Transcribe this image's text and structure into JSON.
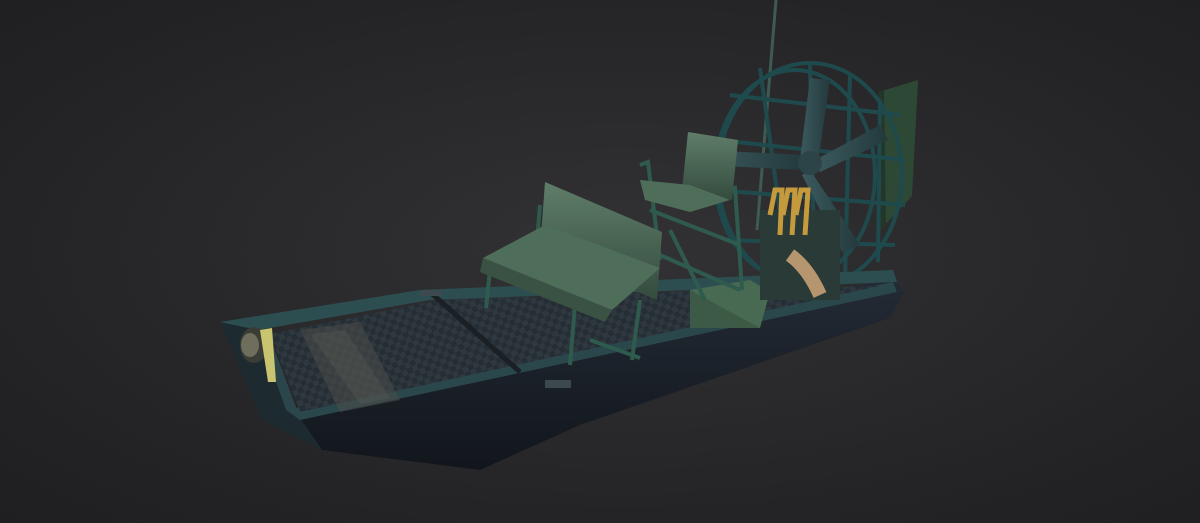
{
  "scene": {
    "subject": "airboat-3d-model",
    "colors": {
      "background": "#2a2a2c",
      "hull_dark": "#151a22",
      "hull_side": "#1c232c",
      "gunwale": "#2c4e50",
      "deck_plate": "#262d33",
      "seat_green": "#3f5a4a",
      "seat_highlight": "#5e7c69",
      "frame_green": "#2f5a4e",
      "cage_teal": "#1f4a4d",
      "rudder": "#2e4836",
      "brass": "#c49a3c",
      "exhaust_tan": "#b5966e",
      "light_yellow": "#c9c470"
    }
  }
}
